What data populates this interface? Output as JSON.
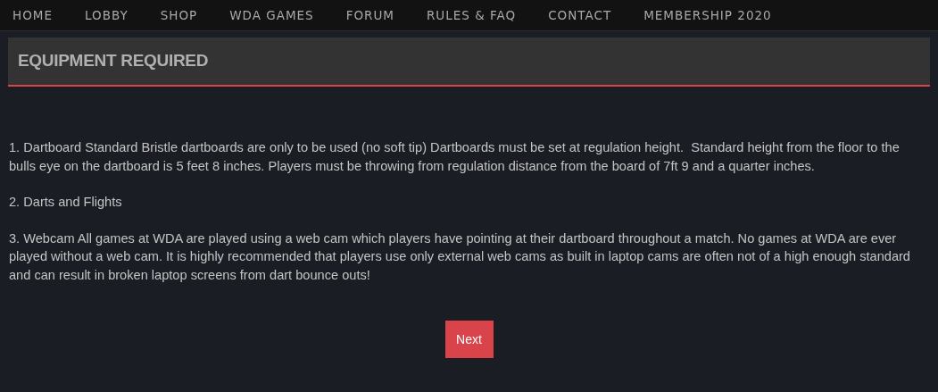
{
  "nav": [
    "HOME",
    "LOBBY",
    "SHOP",
    "WDA GAMES",
    "FORUM",
    "RULES & FAQ",
    "CONTACT",
    "MEMBERSHIP 2020"
  ],
  "panel": {
    "title": "EQUIPMENT REQUIRED"
  },
  "paragraphs": [
    "1. Dartboard Standard Bristle dartboards are only to be used (no soft tip) Dartboards must be set at regulation height.  Standard height from the floor to the bulls eye on the dartboard is 5 feet 8 inches. Players must be throwing from regulation distance from the board of 7ft 9 and a quarter inches.",
    "2. Darts and Flights",
    "3. Webcam All games at WDA are played using a web cam which players have pointing at their dartboard throughout a match. No games at WDA are ever played without a web cam. It is highly recommended that players use only external web cams as built in laptop cams are often not of a high enough standard and can result in broken laptop screens from dart bounce outs!"
  ],
  "button": "Next"
}
